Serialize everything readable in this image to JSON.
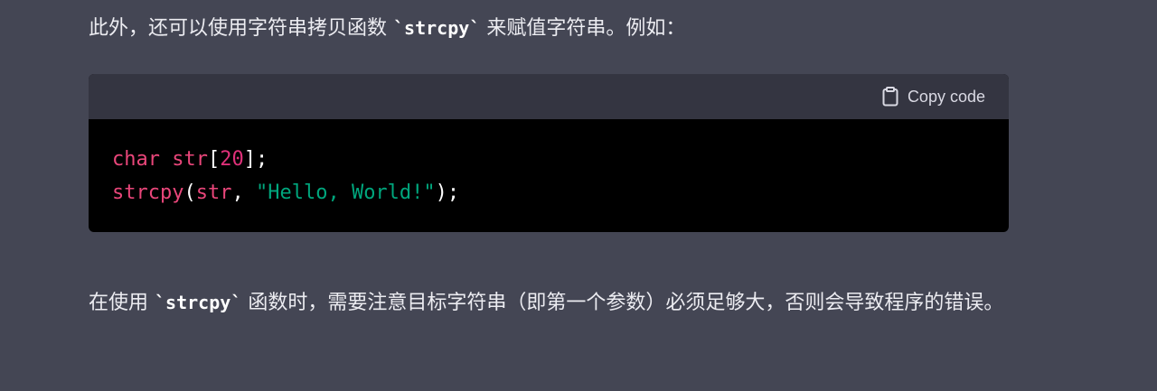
{
  "intro": {
    "before": "此外，还可以使用字符串拷贝函数 ",
    "code": "`strcpy`",
    "after": " 来赋值字符串。例如："
  },
  "code_block": {
    "copy_label": "Copy code",
    "line1": {
      "type": "char",
      "var": "str",
      "open": "[",
      "size": "20",
      "close": "];"
    },
    "line2": {
      "fn": "strcpy",
      "open": "(",
      "arg": "str",
      "comma": ", ",
      "literal": "\"Hello, World!\"",
      "close": ");"
    }
  },
  "note": {
    "before": "在使用 ",
    "code": "`strcpy`",
    "after": " 函数时，需要注意目标字符串（即第一个参数）必须足够大，否则会导致程序的错误。"
  },
  "colors": {
    "page_bg": "#444654",
    "code_header_bg": "#343541",
    "code_bg": "#000000",
    "keyword": "#e9467a",
    "string": "#00a67d"
  }
}
